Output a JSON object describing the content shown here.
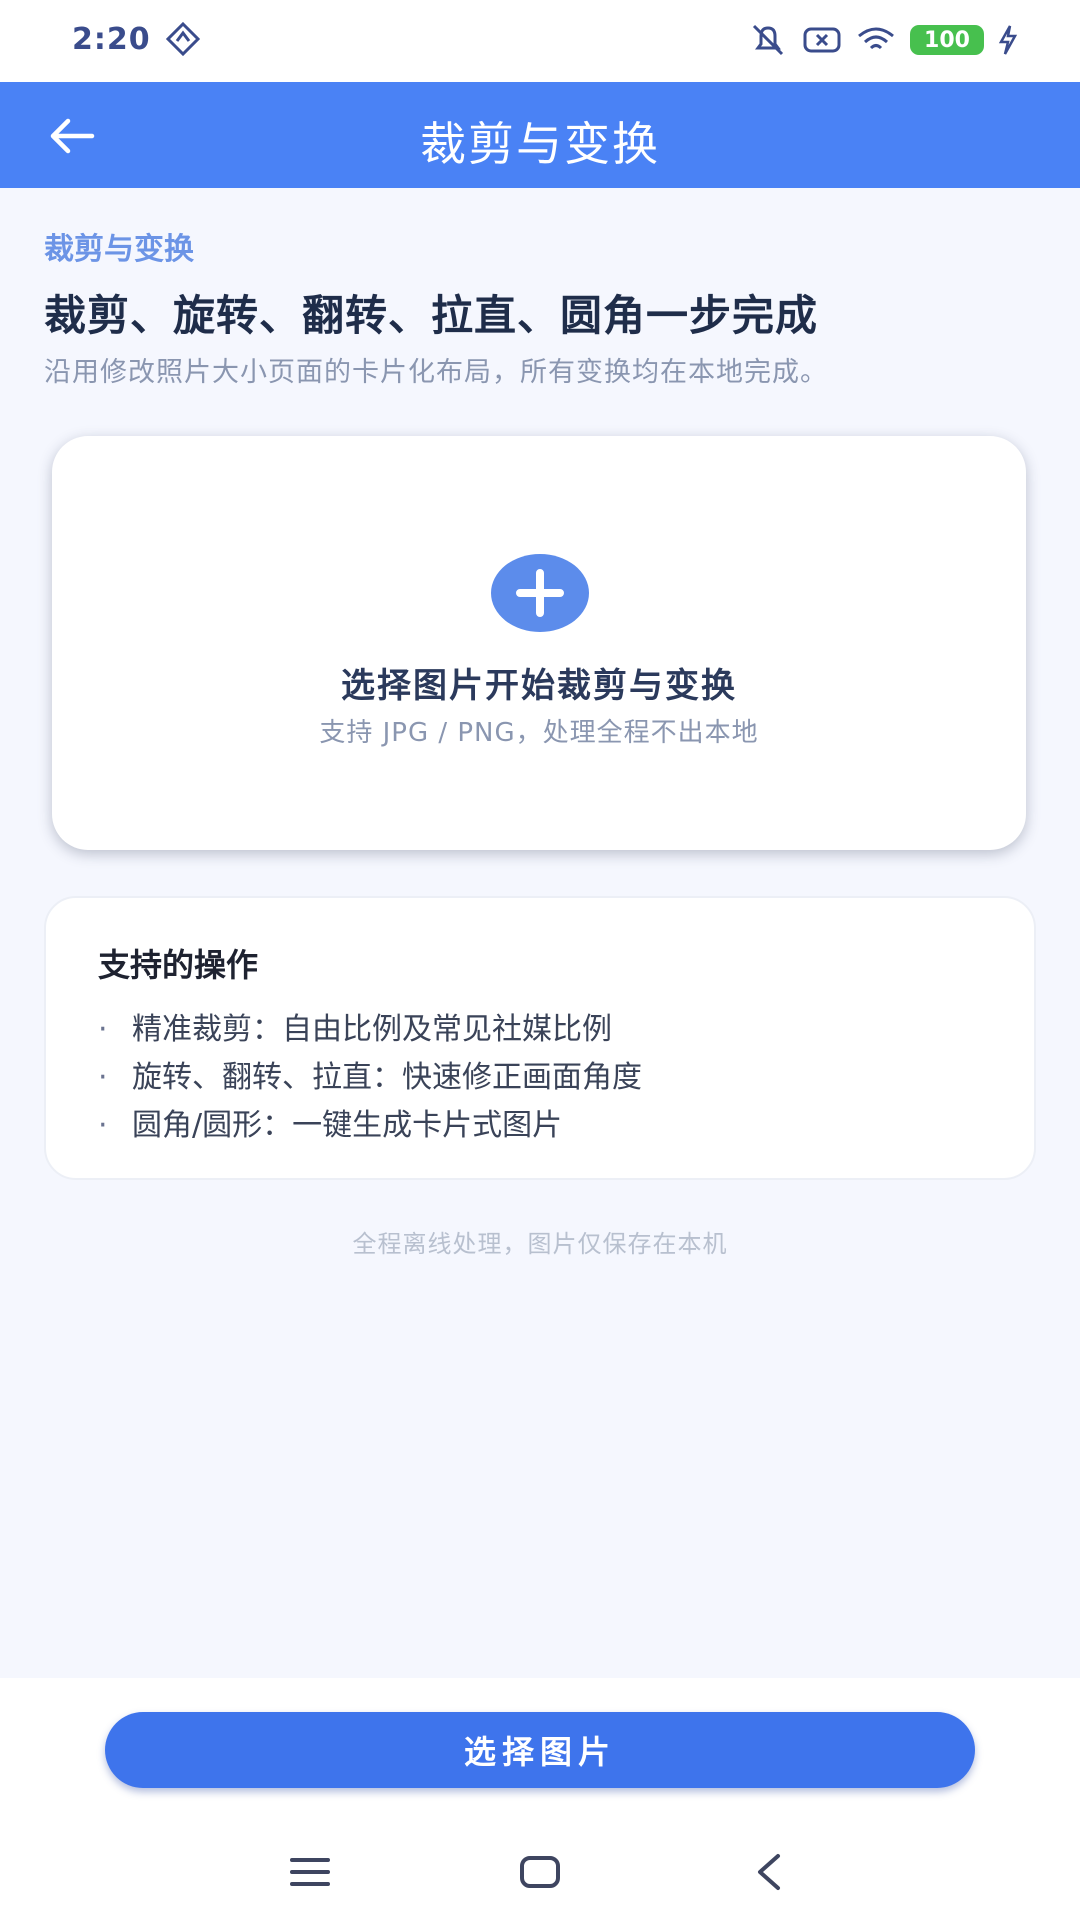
{
  "status_bar": {
    "time": "2:20",
    "battery": "100"
  },
  "app_bar": {
    "title": "裁剪与变换"
  },
  "intro": {
    "eyebrow": "裁剪与变换",
    "headline": "裁剪、旋转、翻转、拉直、圆角一步完成",
    "subhead": "沿用修改照片大小页面的卡片化布局，所有变换均在本地完成。"
  },
  "upload_card": {
    "title": "选择图片开始裁剪与变换",
    "subtitle": "支持 JPG / PNG，处理全程不出本地"
  },
  "features": {
    "title": "支持的操作",
    "items": [
      "精准裁剪：自由比例及常见社媒比例",
      "旋转、翻转、拉直：快速修正画面角度",
      "圆角/圆形：一键生成卡片式图片"
    ]
  },
  "footnote": "全程离线处理，图片仅保存在本机",
  "primary_button": {
    "label": "选择图片"
  },
  "colors": {
    "accent": "#4A82F5",
    "button": "#3E74EC",
    "background": "#F5F7FE",
    "battery": "#47C04E"
  },
  "icons": {
    "back": "arrow-left-icon",
    "add": "plus-icon",
    "nav_menu": "menu-icon",
    "nav_home": "home-square-icon",
    "nav_back": "chevron-left-icon"
  }
}
